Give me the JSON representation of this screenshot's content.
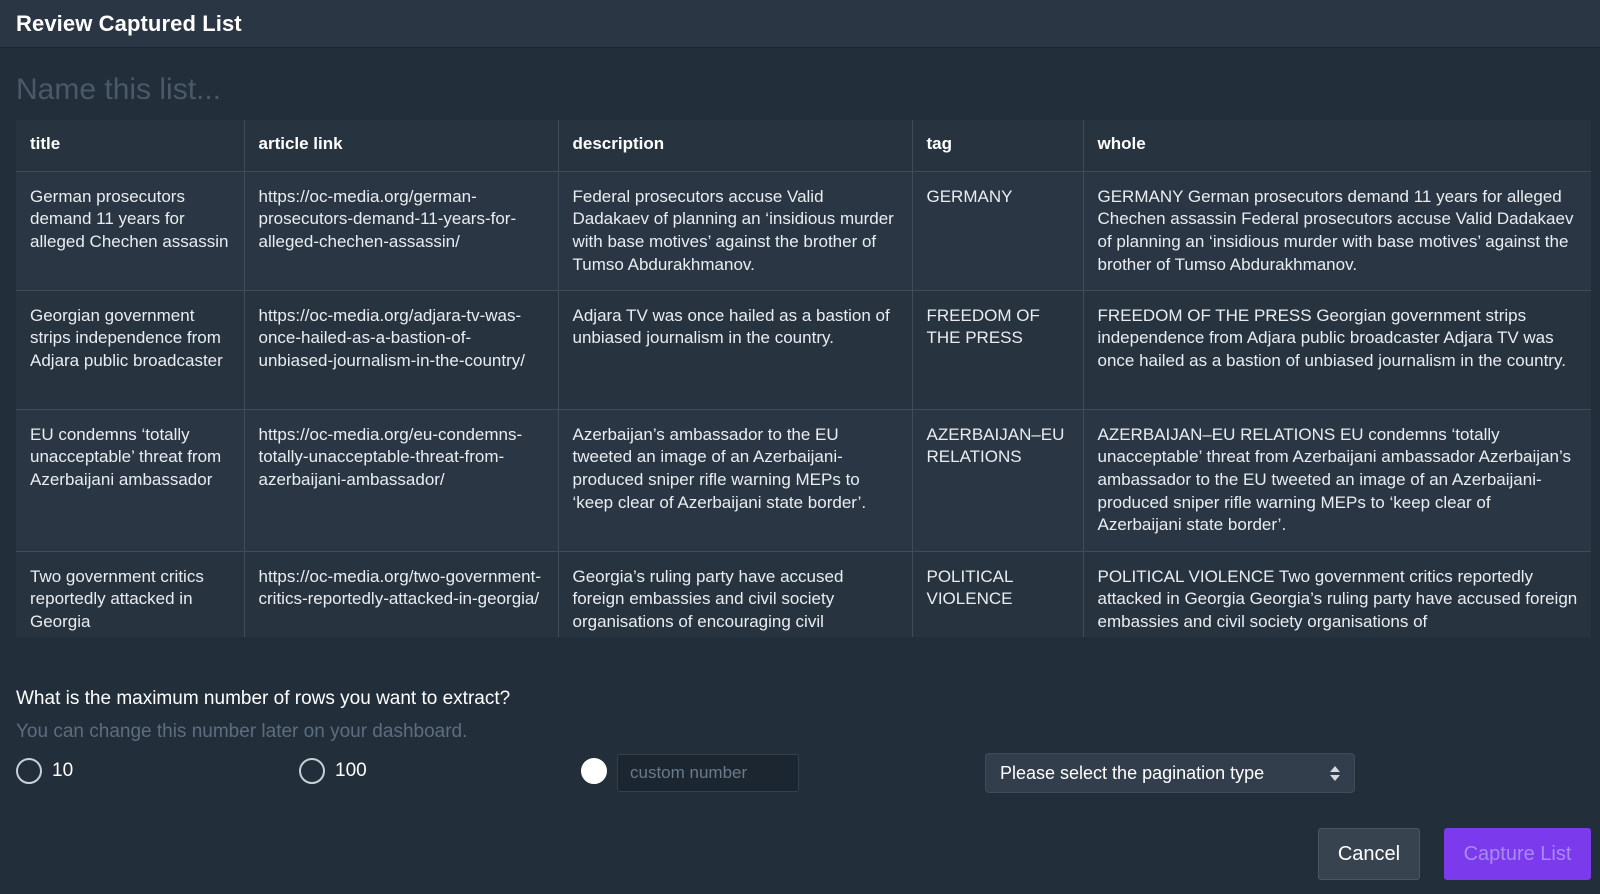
{
  "header": {
    "title": "Review Captured List"
  },
  "list_name": {
    "placeholder": "Name this list...",
    "value": ""
  },
  "table": {
    "columns": [
      "title",
      "article link",
      "description",
      "tag",
      "whole"
    ],
    "rows": [
      [
        "German prosecutors demand 11 years for alleged Chechen assassin",
        "https://oc-media.org/german-prosecutors-demand-11-years-for-alleged-chechen-assassin/",
        "Federal prosecutors accuse Valid Dadakaev of planning an ‘insidious murder with base motives’ against the brother of Tumso Abdurakhmanov.",
        "GERMANY",
        "GERMANY German prosecutors demand 11 years for alleged Chechen assassin Federal prosecutors accuse Valid Dadakaev of planning an ‘insidious murder with base motives’ against the brother of Tumso Abdurakhmanov."
      ],
      [
        "Georgian government strips independence from Adjara public broadcaster",
        "https://oc-media.org/adjara-tv-was-once-hailed-as-a-bastion-of-unbiased-journalism-in-the-country/",
        "Adjara TV was once hailed as a bastion of unbiased journalism in the country.",
        "FREEDOM OF THE PRESS",
        "FREEDOM OF THE PRESS Georgian government strips independence from Adjara public broadcaster Adjara TV was once hailed as a bastion of unbiased journalism in the country."
      ],
      [
        "EU condemns ‘totally unacceptable’ threat from Azerbaijani ambassador",
        "https://oc-media.org/eu-condemns-totally-unacceptable-threat-from-azerbaijani-ambassador/",
        "Azerbaijan’s ambassador to the EU tweeted an image of an Azerbaijani-produced sniper rifle warning MEPs to ‘keep clear of Azerbaijani state border’.",
        "AZERBAIJAN–EU RELATIONS",
        "AZERBAIJAN–EU RELATIONS EU condemns ‘totally unacceptable’ threat from Azerbaijani ambassador Azerbaijan’s ambassador to the EU tweeted an image of an Azerbaijani-produced sniper rifle warning MEPs to ‘keep clear of Azerbaijani state border’."
      ],
      [
        "Two government critics reportedly attacked in Georgia",
        "https://oc-media.org/two-government-critics-reportedly-attacked-in-georgia/",
        "Georgia’s ruling party have accused foreign embassies and civil society organisations of encouraging civil",
        "POLITICAL VIOLENCE",
        "POLITICAL VIOLENCE Two government critics reportedly attacked in Georgia Georgia’s ruling party have accused foreign embassies and civil society organisations of"
      ]
    ]
  },
  "limit": {
    "question": "What is the maximum number of rows you want to extract?",
    "hint": "You can change this number later on your dashboard.",
    "options": [
      {
        "label": "10",
        "selected": false
      },
      {
        "label": "100",
        "selected": false
      },
      {
        "label": "",
        "selected": true
      }
    ],
    "custom_placeholder": "custom number"
  },
  "pagination": {
    "selected": "Please select the pagination type"
  },
  "buttons": {
    "cancel": "Cancel",
    "capture": "Capture List"
  },
  "colors": {
    "background": "#222e3a",
    "accent": "#7c3aed",
    "row_alt": "#2a3643"
  }
}
